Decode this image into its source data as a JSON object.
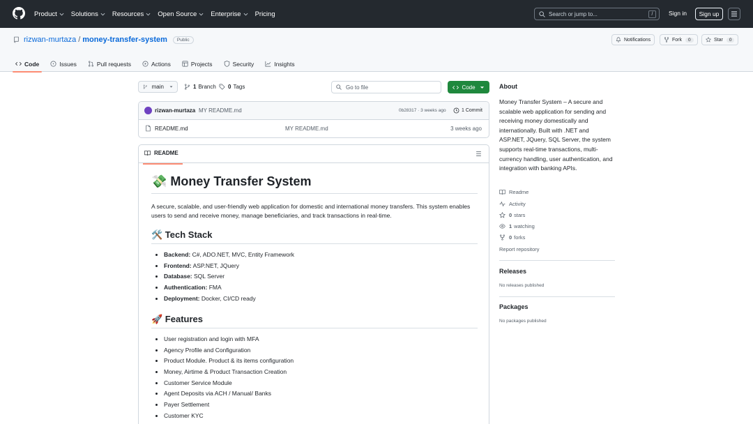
{
  "header": {
    "nav": [
      "Product",
      "Solutions",
      "Resources",
      "Open Source",
      "Enterprise",
      "Pricing"
    ],
    "search_placeholder": "Search or jump to...",
    "slash_key": "/",
    "signin": "Sign in",
    "signup": "Sign up"
  },
  "repo": {
    "owner": "rizwan-murtaza",
    "separator": "/",
    "name": "money-transfer-system",
    "visibility": "Public",
    "notifications_label": "Notifications",
    "fork_label": "Fork",
    "fork_count": "0",
    "star_label": "Star",
    "star_count": "0",
    "tabs": [
      "Code",
      "Issues",
      "Pull requests",
      "Actions",
      "Projects",
      "Security",
      "Insights"
    ]
  },
  "toolbar": {
    "branch": "main",
    "branch_count": "1",
    "branch_label": "Branch",
    "tag_count": "0",
    "tag_label": "Tags",
    "go_to_file": "Go to file",
    "code_button": "Code"
  },
  "commit": {
    "author": "rizwan-murtaza",
    "message": "MY README.md",
    "sha_time": "0b28317 · 3 weeks ago",
    "commits": "1 Commit"
  },
  "files": [
    {
      "name": "README.md",
      "message": "MY README.md",
      "date": "3 weeks ago"
    }
  ],
  "readme": {
    "label": "README",
    "title": "💸 Money Transfer System",
    "intro": "A secure, scalable, and user-friendly web application for domestic and international money transfers. This system enables users to send and receive money, manage beneficiaries, and track transactions in real-time.",
    "tech_heading": "🛠️ Tech Stack",
    "tech": [
      {
        "k": "Backend:",
        "v": "C#, ADO.NET, MVC, Entity Framework"
      },
      {
        "k": "Frontend:",
        "v": "ASP.NET, JQuery"
      },
      {
        "k": "Database:",
        "v": "SQL Server"
      },
      {
        "k": "Authentication:",
        "v": "FMA"
      },
      {
        "k": "Deployment:",
        "v": "Docker, CI/CD ready"
      }
    ],
    "features_heading": "🚀 Features",
    "features": [
      "User registration and login with MFA",
      "Agency Profile and Configuration",
      "Product Module. Product & its items configuration",
      "Money, Airtime & Product Transaction Creation",
      "Customer Service Module",
      "Agent Deposits via ACH / Manual/ Banks",
      "Payer Settlement",
      "Customer KYC"
    ]
  },
  "sidebar": {
    "about_title": "About",
    "about_text": "Money Transfer System – A secure and scalable web application for sending and receiving money domestically and internationally. Built with .NET and ASP.NET, JQuery, SQL Server, the system supports real-time transactions, multi-currency handling, user authentication, and integration with banking APIs.",
    "readme_link": "Readme",
    "activity_link": "Activity",
    "stars_count": "0",
    "stars_label": "stars",
    "watching_count": "1",
    "watching_label": "watching",
    "forks_count": "0",
    "forks_label": "forks",
    "report": "Report repository",
    "releases_title": "Releases",
    "releases_text": "No releases published",
    "packages_title": "Packages",
    "packages_text": "No packages published"
  }
}
